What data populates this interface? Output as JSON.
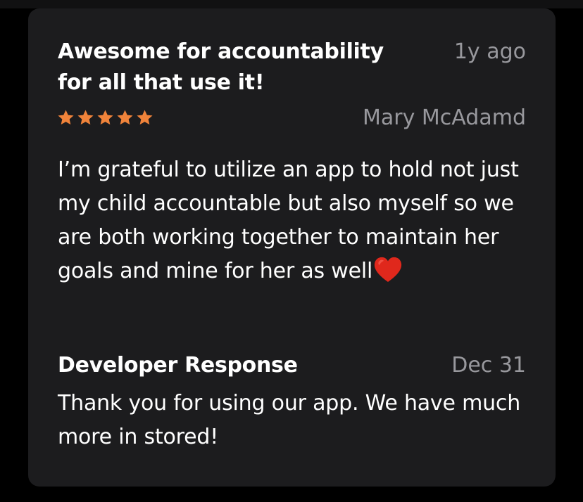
{
  "review": {
    "title": "Awesome for accountability for all that use it!",
    "date": "1y ago",
    "rating": 5,
    "rating_max": 5,
    "star_color": "#f0833a",
    "author": "Mary McAdamd",
    "body": "I’m grateful to utilize an app to hold not just my child accountable but also myself so we are both working together to maintain her goals and mine for her as well",
    "body_emoji": "red-heart-icon"
  },
  "developer_response": {
    "heading": "Developer Response",
    "date": "Dec 31",
    "body": "Thank you for using our app. We have much more in stored!"
  },
  "colors": {
    "background": "#000000",
    "card": "#1c1c1e",
    "primary_text": "#ffffff",
    "secondary_text": "#98989d"
  }
}
